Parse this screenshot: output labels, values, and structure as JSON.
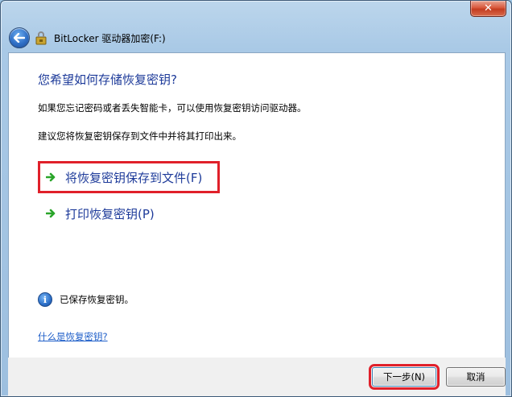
{
  "window": {
    "title": "BitLocker 驱动器加密(F:)",
    "close_glyph": "✕"
  },
  "content": {
    "heading": "您希望如何存储恢复密钥?",
    "desc1": "如果您忘记密码或者丢失智能卡，可以使用恢复密钥访问驱动器。",
    "desc2": "建议您将恢复密钥保存到文件中并将其打印出来。",
    "options": [
      {
        "label": "将恢复密钥保存到文件(F)",
        "icon": "green-arrow-icon"
      },
      {
        "label": "打印恢复密钥(P)",
        "icon": "green-arrow-icon"
      }
    ],
    "status": {
      "text": "已保存恢复密钥。",
      "icon": "info-icon",
      "icon_glyph": "i"
    },
    "help_link": "什么是恢复密钥?"
  },
  "footer": {
    "next_label": "下一步(N)",
    "cancel_label": "取消"
  },
  "colors": {
    "heading": "#1e3b9a",
    "highlight": "#e0202a",
    "link": "#1f5fc9",
    "arrow": "#2aa52a"
  }
}
